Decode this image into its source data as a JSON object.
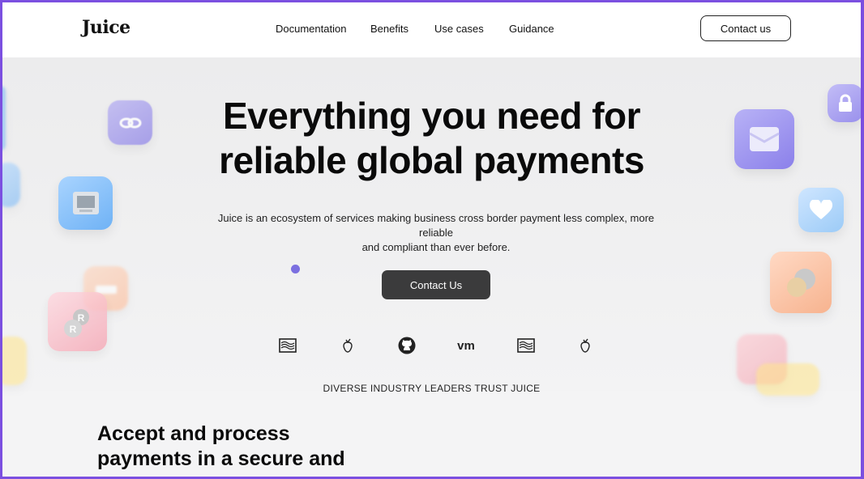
{
  "brand": {
    "logo_text": "Juice"
  },
  "nav": {
    "items": [
      {
        "label": "Documentation"
      },
      {
        "label": "Benefits"
      },
      {
        "label": "Use cases"
      },
      {
        "label": "Guidance"
      }
    ],
    "contact_label": "Contact us"
  },
  "hero": {
    "headline_line1": "Everything you need for",
    "headline_line2": "reliable global payments",
    "subtext_line1": "Juice is an ecosystem of services making business cross border payment less complex, more reliable",
    "subtext_line2": "and compliant than ever before.",
    "cta_label": "Contact Us"
  },
  "partners": {
    "logos": [
      {
        "icon": "waves-logo-icon"
      },
      {
        "icon": "strawberry-logo-icon"
      },
      {
        "icon": "github-logo-icon"
      },
      {
        "text": "vm",
        "icon": "vm-logo-icon"
      },
      {
        "icon": "waves-logo-icon"
      },
      {
        "icon": "strawberry-logo-icon"
      }
    ],
    "trust_text": "DIVERSE INDUSTRY LEADERS TRUST JUICE"
  },
  "section2": {
    "heading_line1": "Accept and process",
    "heading_line2": "payments in a secure and"
  },
  "colors": {
    "frame": "#7b4fe0",
    "accent_dot": "#7b6fe0",
    "cta_bg": "#3b3b3c"
  }
}
